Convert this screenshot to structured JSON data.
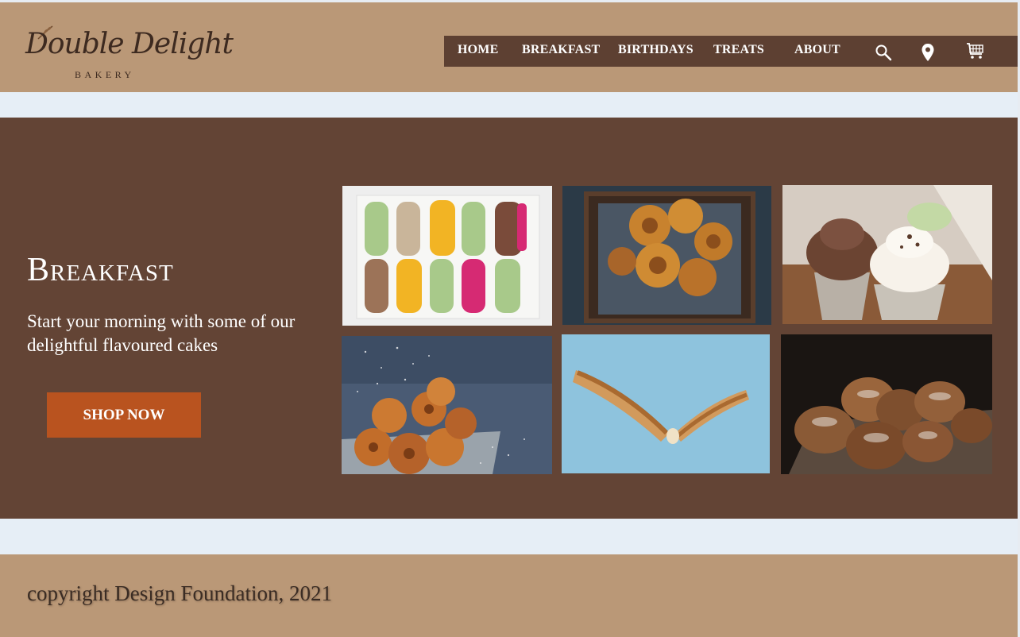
{
  "brand": {
    "name": "Double Delight",
    "tagline": "BAKERY"
  },
  "nav": {
    "items": [
      {
        "label": "HOME"
      },
      {
        "label": "BREAKFAST"
      },
      {
        "label": "BIRTHDAYS"
      },
      {
        "label": "TREATS"
      },
      {
        "label": "ABOUT"
      }
    ],
    "icons": [
      "search-icon",
      "location-pin-icon",
      "shopping-cart-icon"
    ]
  },
  "hero": {
    "title": "Breakfast",
    "subtitle": "Start your morning with some of our delightful flavoured cakes",
    "cta_label": "SHOP NOW"
  },
  "gallery": {
    "photos": [
      "macarons-photo",
      "cinnamon-buns-photo",
      "cupcakes-photo",
      "bundt-cakes-photo",
      "baguette-photo",
      "bread-loaves-photo"
    ]
  },
  "footer": {
    "copyright": "copyright Design Foundation, 2021"
  },
  "colors": {
    "header_bg": "#ba9877",
    "nav_bg": "#5d4032",
    "hero_bg": "#634435",
    "cta_bg": "#b9531f",
    "page_bg": "#e6eef6"
  }
}
